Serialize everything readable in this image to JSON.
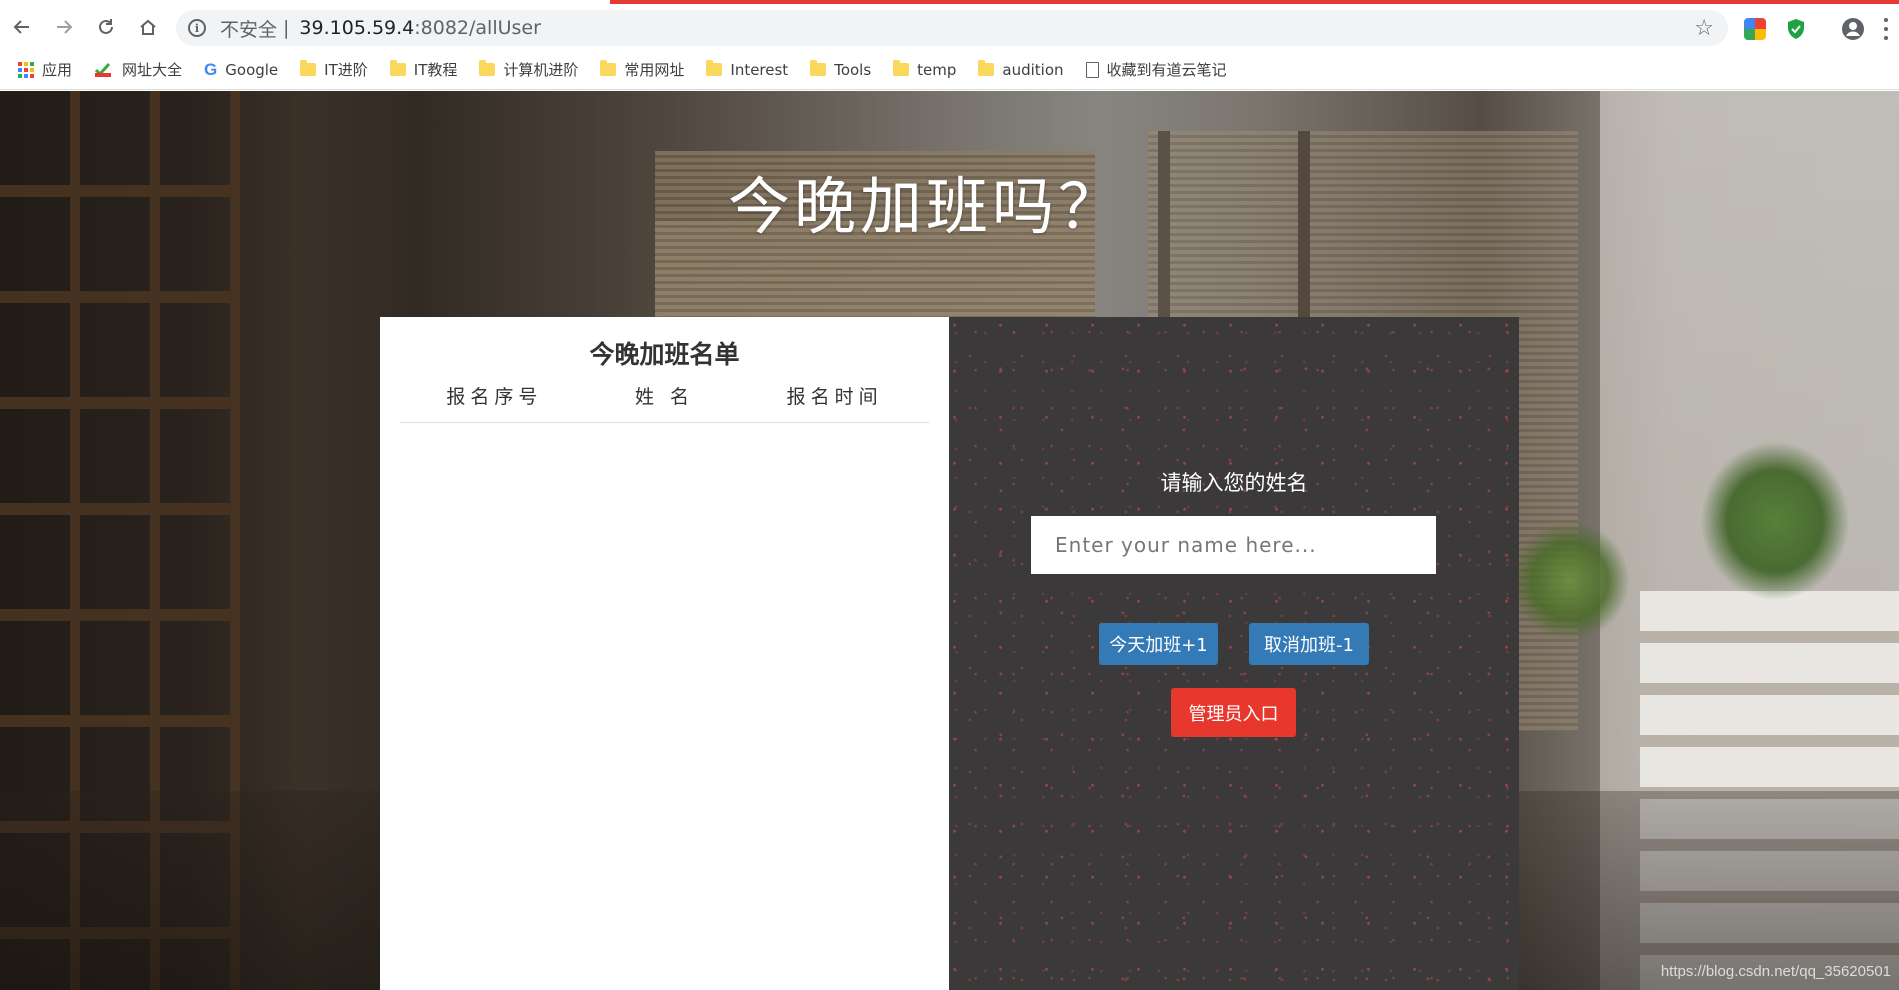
{
  "browser": {
    "url_security": "不安全",
    "url_separator": "|",
    "url_host": "39.105.59.4",
    "url_path": ":8082/allUser",
    "bookmarks": [
      {
        "label": "应用",
        "icon": "apps-icon"
      },
      {
        "label": "网址大全",
        "icon": "hao123-icon"
      },
      {
        "label": "Google",
        "icon": "google-icon"
      },
      {
        "label": "IT进阶",
        "icon": "folder-icon"
      },
      {
        "label": "IT教程",
        "icon": "folder-icon"
      },
      {
        "label": "计算机进阶",
        "icon": "folder-icon"
      },
      {
        "label": "常用网址",
        "icon": "folder-icon"
      },
      {
        "label": "Interest",
        "icon": "folder-icon"
      },
      {
        "label": "Tools",
        "icon": "folder-icon"
      },
      {
        "label": "temp",
        "icon": "folder-icon"
      },
      {
        "label": "audition",
        "icon": "folder-icon"
      },
      {
        "label": "收藏到有道云笔记",
        "icon": "document-icon"
      }
    ],
    "accent_color": "#e53935"
  },
  "page": {
    "title": "今晚加班吗？",
    "watermark": "https://blog.csdn.net/qq_35620501"
  },
  "list": {
    "title": "今晚加班名单",
    "columns": [
      "报名序号",
      "姓 名",
      "报名时间"
    ],
    "rows": []
  },
  "form": {
    "label": "请输入您的姓名",
    "input_placeholder": "Enter your name here...",
    "input_value": "",
    "add_button": "今天加班+1",
    "cancel_button": "取消加班-1",
    "admin_button": "管理员入口",
    "button_color": "#337ab7",
    "admin_color": "#e8372d",
    "panel_color": "#3b393a"
  }
}
